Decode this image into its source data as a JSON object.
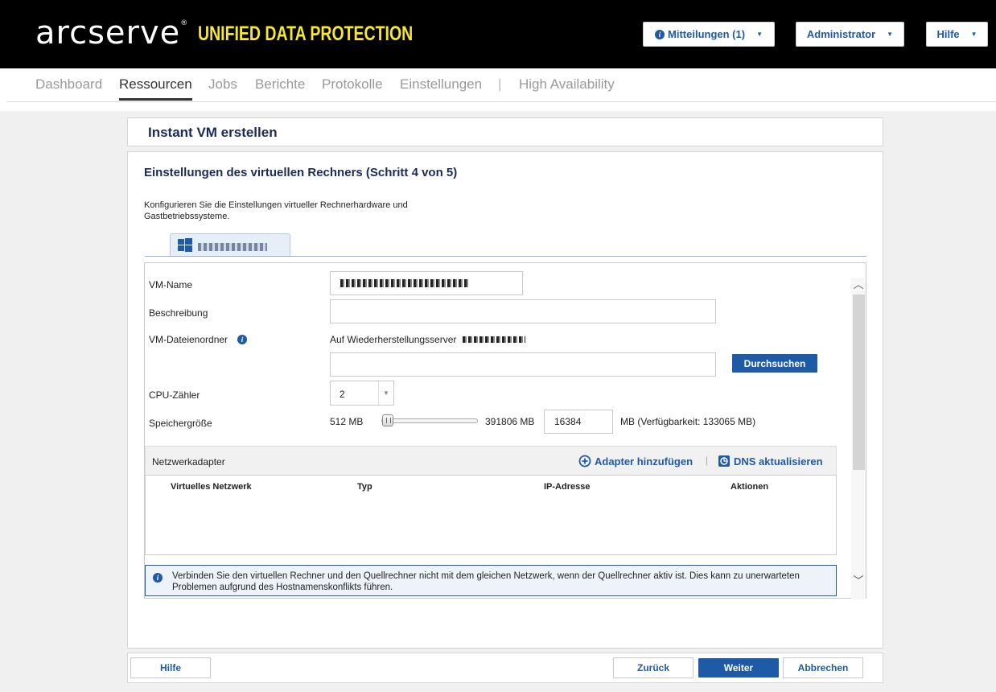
{
  "header": {
    "logo_text": "arcserve",
    "logo_mark": "®",
    "product": "UNIFIED DATA PROTECTION",
    "notifications_label": "Mitteilungen (1)",
    "admin_label": "Administrator",
    "help_label": "Hilfe"
  },
  "nav": {
    "items": [
      {
        "label": "Dashboard",
        "active": false
      },
      {
        "label": "Ressourcen",
        "active": true
      },
      {
        "label": "Jobs",
        "active": false
      },
      {
        "label": "Berichte",
        "active": false
      },
      {
        "label": "Protokolle",
        "active": false
      },
      {
        "label": "Einstellungen",
        "active": false
      },
      {
        "label": "High Availability",
        "active": false
      }
    ],
    "separator": "|"
  },
  "page": {
    "title": "Instant VM erstellen",
    "step_title": "Einstellungen des virtuellen Rechners (Schritt 4 von 5)",
    "description": "Konfigurieren Sie die Einstellungen virtueller Rechnerhardware und Gastbetriebssysteme."
  },
  "form": {
    "vm_name_label": "VM-Name",
    "description_label": "Beschreibung",
    "description_value": "",
    "folder_label": "VM-Dateienordner",
    "folder_server_text": "Auf Wiederherstellungsserver",
    "folder_path_value": "",
    "browse_label": "Durchsuchen",
    "cpu_label": "CPU-Zähler",
    "cpu_value": "2",
    "memory_label": "Speichergröße",
    "memory_min": "512 MB",
    "memory_max": "391806 MB",
    "memory_value": "16384",
    "memory_avail": "MB (Verfügbarkeit: 133065 MB)"
  },
  "network": {
    "title": "Netzwerkadapter",
    "add_label": "Adapter hinzufügen",
    "dns_label": "DNS aktualisieren",
    "separator": "|",
    "columns": [
      "Virtuelles Netzwerk",
      "Typ",
      "IP-Adresse",
      "Aktionen"
    ]
  },
  "notice": "Verbinden Sie den virtuellen Rechner und den Quellrechner nicht mit dem gleichen Netzwerk, wenn der Quellrechner aktiv ist. Dies kann zu unerwarteten Problemen aufgrund des Hostnamenskonflikts führen.",
  "footer": {
    "help_label": "Hilfe",
    "back_label": "Zurück",
    "next_label": "Weiter",
    "cancel_label": "Abbrechen"
  },
  "icons": {
    "info": "info-icon",
    "windows": "windows-icon",
    "add": "plus-circle-icon",
    "dns": "dns-refresh-icon",
    "caret": "caret-down-icon"
  },
  "colors": {
    "brand_yellow": "#f7e82a",
    "primary_blue": "#1f5aa6",
    "title_navy": "#1a2a5a"
  }
}
